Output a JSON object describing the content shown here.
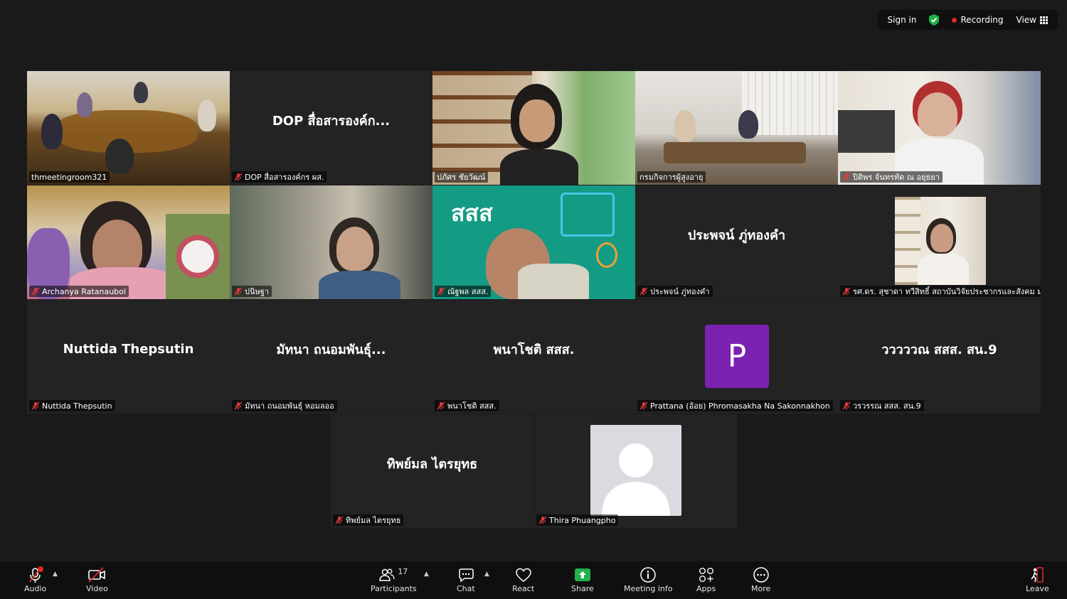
{
  "topbar": {
    "sign_in": "Sign in",
    "recording": "Recording",
    "view": "View"
  },
  "tiles": [
    {
      "label": "thmeetingroom321",
      "muted": false
    },
    {
      "center": "DOP สื่อสารองค์ก...",
      "label": "DOP สื่อสารองค์กร ผส.",
      "muted": true
    },
    {
      "label": "ปภัศร ชัยวัฒน์",
      "muted": false
    },
    {
      "label": "กรมกิจการผู้สูงอายุ",
      "muted": false
    },
    {
      "label": "ปิติพร จันทรทัต ณ อยุธยา",
      "muted": true
    },
    {
      "label": "Archanya Ratanaubol",
      "muted": true
    },
    {
      "label": "ปนิษฐา",
      "muted": true
    },
    {
      "label": "ณัฐพล สสส.",
      "muted": true
    },
    {
      "center": "ประพจน์ ภู่ทองคำ",
      "label": "ประพจน์ ภู่ทองคำ",
      "muted": true
    },
    {
      "label": "รศ.ดร. สุชาดา ทวีสิทธิ์ สถาบันวิจัยประชากรและสังคม ม....",
      "muted": true
    },
    {
      "center": "Nuttida Thepsutin",
      "label": "Nuttida Thepsutin",
      "muted": true
    },
    {
      "center": "มัทนา ถนอมพันธุ์...",
      "label": "มัทนา ถนอมพันธุ์ หอมลออ",
      "muted": true
    },
    {
      "center": "พนาโชติ สสส.",
      "label": "พนาโชติ สสส.",
      "muted": true
    },
    {
      "avatar_letter": "P",
      "label": "Prattana (อ้อย) Phromasakha Na Sakonnakhon",
      "muted": true
    },
    {
      "center": "วววววณ สสส. สน.9",
      "label": "วรวรรณ สสส. สน.9",
      "muted": true
    },
    {
      "center": "ทิพย์มล ไตรยุทธ",
      "label": "ทิพย์มล ไตรยุทธ",
      "muted": true
    },
    {
      "label": "Thira Phuangpho",
      "muted": true
    }
  ],
  "toolbar": {
    "audio": "Audio",
    "video": "Video",
    "participants": "Participants",
    "participants_count": "17",
    "chat": "Chat",
    "react": "React",
    "share": "Share",
    "meeting_info": "Meeting info",
    "apps": "Apps",
    "more": "More",
    "leave": "Leave"
  },
  "colors": {
    "active_speaker": "#2fd36a",
    "avatar_purple": "#7b22b0",
    "share_green": "#22b14c",
    "recording_red": "#e02828"
  }
}
